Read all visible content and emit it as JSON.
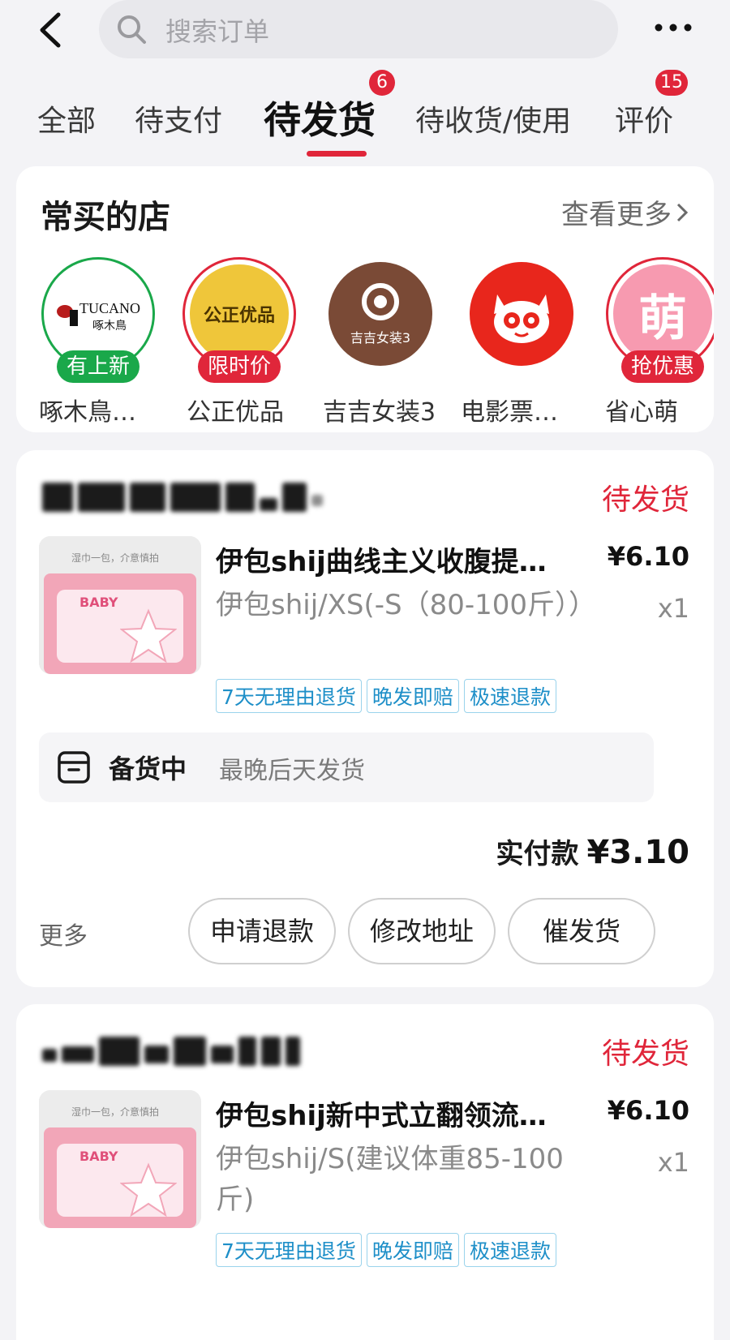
{
  "search": {
    "placeholder": "搜索订单"
  },
  "tabs": [
    {
      "label": "全部"
    },
    {
      "label": "待支付"
    },
    {
      "label": "待发货",
      "badge": "6",
      "active": true
    },
    {
      "label": "待收货/使用"
    },
    {
      "label": "评价",
      "badge": "15"
    }
  ],
  "frequent_shops": {
    "title": "常买的店",
    "see_more": "查看更多",
    "shops": [
      {
        "name": "啄木鳥…",
        "tag": "有上新",
        "logo_text": "TUCANO",
        "logo_sub": "啄木鳥"
      },
      {
        "name": "公正优品",
        "tag": "限时价",
        "logo_text": "公正优品"
      },
      {
        "name": "吉吉女装3",
        "logo_text": "吉吉女装3"
      },
      {
        "name": "电影票…"
      },
      {
        "name": "省心萌",
        "tag": "抢优惠",
        "logo_text": "萌"
      }
    ]
  },
  "orders": [
    {
      "status": "待发货",
      "title": "伊包shij曲线主义收腹提…",
      "price": "¥6.10",
      "spec": "伊包shij/XS(-S（80-100斤））",
      "qty": "x1",
      "guarantees": [
        "7天无理由退货",
        "晚发即赔",
        "极速退款"
      ],
      "shipping_state": "备货中",
      "shipping_desc": "最晚后天发货",
      "paid_label": "实付款",
      "paid_value": "¥3.10",
      "more": "更多",
      "actions": [
        "申请退款",
        "修改地址",
        "催发货"
      ],
      "thumb_caption": "湿巾一包，介意慎拍",
      "thumb_brand": "BABY"
    },
    {
      "status": "待发货",
      "title": "伊包shij新中式立翻领流…",
      "price": "¥6.10",
      "spec": "伊包shij/S(建议体重85-100斤)",
      "qty": "x1",
      "guarantees": [
        "7天无理由退货",
        "晚发即赔",
        "极速退款"
      ],
      "thumb_caption": "湿巾一包，介意慎拍",
      "thumb_brand": "BABY"
    }
  ],
  "colors": {
    "accent": "#e0263a",
    "tag_green": "#1aa84a",
    "tag_red": "#e0263a",
    "guarantee_blue": "#1e8fc8"
  }
}
